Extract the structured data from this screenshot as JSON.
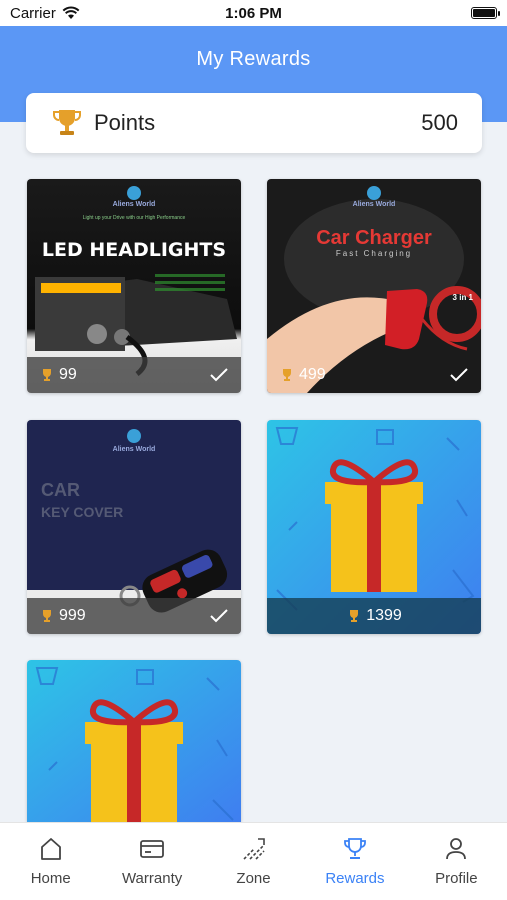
{
  "status_bar": {
    "carrier": "Carrier",
    "time": "1:06 PM"
  },
  "header": {
    "title": "My Rewards"
  },
  "points": {
    "label": "Points",
    "value": "500"
  },
  "rewards": [
    {
      "brand": "Aliens World",
      "title": "LED HEADLIGHTS",
      "tagline": "Light up your Drive with our High Performance",
      "points": "99",
      "redeemable": true
    },
    {
      "brand": "Aliens World",
      "title": "Car Charger",
      "subtitle": "Fast Charging",
      "badge": "3 in 1",
      "points": "499",
      "redeemable": true
    },
    {
      "brand": "Aliens World",
      "title_line1": "CAR",
      "title_line2": "KEY COVER",
      "points": "999",
      "redeemable": true
    },
    {
      "points": "1399",
      "redeemable": false
    },
    {
      "points": "",
      "redeemable": false
    }
  ],
  "tabs": [
    {
      "label": "Home",
      "icon": "home-icon"
    },
    {
      "label": "Warranty",
      "icon": "card-icon"
    },
    {
      "label": "Zone",
      "icon": "zone-icon"
    },
    {
      "label": "Rewards",
      "icon": "trophy-icon",
      "active": true
    },
    {
      "label": "Profile",
      "icon": "profile-icon"
    }
  ],
  "colors": {
    "header": "#5b97f5",
    "active_tab": "#3b82f6",
    "gift_ribbon": "#c62828",
    "gift_box": "#f5c21b"
  }
}
